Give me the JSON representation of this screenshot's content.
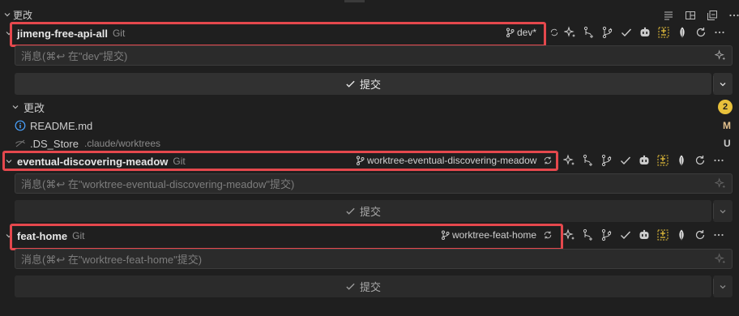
{
  "header": {
    "section_title": "更改"
  },
  "colors": {
    "highlight": "#e5484d",
    "badge": "#e8c13b",
    "modified": "#e2c08d",
    "untracked": "#73c991"
  },
  "repos": [
    {
      "name": "jimeng-free-api-all",
      "kind": "Git",
      "branch": "dev*",
      "message_placeholder": "消息(⌘↩ 在\"dev\"提交)",
      "commit_label": "提交",
      "changes_title": "更改",
      "changes_count": "2",
      "files": [
        {
          "name": "README.md",
          "path": "",
          "status": "M",
          "icon": "info-icon"
        },
        {
          "name": ".DS_Store",
          "path": ".claude/worktrees",
          "status": "U",
          "icon": "eye-closed-icon"
        }
      ]
    },
    {
      "name": "eventual-discovering-meadow",
      "kind": "Git",
      "branch": "worktree-eventual-discovering-meadow",
      "message_placeholder": "消息(⌘↩ 在\"worktree-eventual-discovering-meadow\"提交)",
      "commit_label": "提交"
    },
    {
      "name": "feat-home",
      "kind": "Git",
      "branch": "worktree-feat-home",
      "message_placeholder": "消息(⌘↩ 在\"worktree-feat-home\"提交)",
      "commit_label": "提交"
    }
  ],
  "icons": {
    "toolbar": [
      "list-view-icon",
      "split-icon",
      "collapse-icon",
      "more-icon"
    ],
    "repo_actions": [
      "sparkle-icon",
      "branch-add-icon",
      "graph-icon",
      "checkmark-icon",
      "copilot-icon",
      "diff-icon",
      "leaf-icon",
      "refresh-icon",
      "more-icon"
    ]
  }
}
